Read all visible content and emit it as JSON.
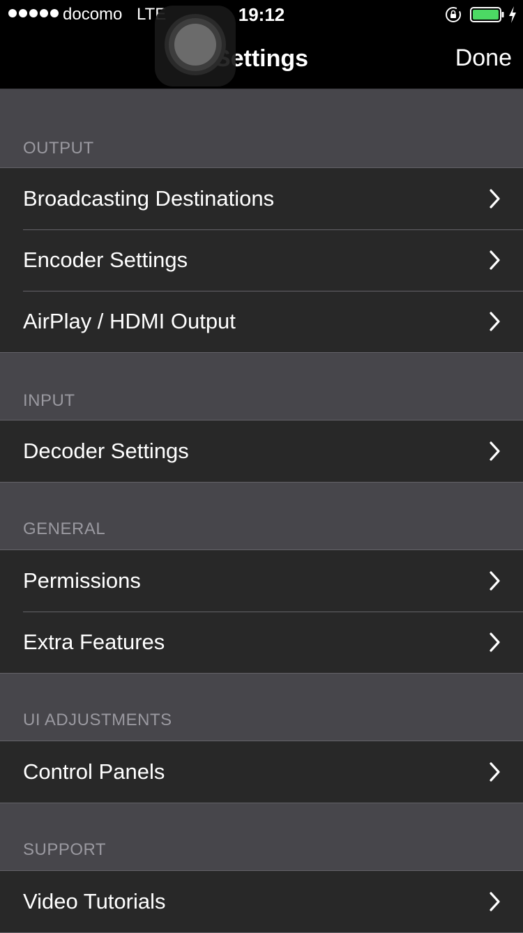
{
  "status_bar": {
    "carrier": "docomo",
    "network": "LTE",
    "time": "19:12",
    "signal_bars": 5
  },
  "nav": {
    "title": "Settings",
    "done_label": "Done"
  },
  "sections": [
    {
      "header": "OUTPUT",
      "items": [
        {
          "label": "Broadcasting Destinations"
        },
        {
          "label": "Encoder Settings"
        },
        {
          "label": "AirPlay / HDMI Output"
        }
      ]
    },
    {
      "header": "INPUT",
      "items": [
        {
          "label": "Decoder Settings"
        }
      ]
    },
    {
      "header": "GENERAL",
      "items": [
        {
          "label": "Permissions"
        },
        {
          "label": "Extra Features"
        }
      ]
    },
    {
      "header": "UI ADJUSTMENTS",
      "items": [
        {
          "label": "Control Panels"
        }
      ]
    },
    {
      "header": "SUPPORT",
      "items": [
        {
          "label": "Video Tutorials"
        }
      ]
    }
  ],
  "icons": {
    "chevron": "chevron-right-icon",
    "lock": "rotation-lock-icon",
    "battery": "battery-icon",
    "charging": "charging-bolt-icon",
    "assistive": "assistive-touch-icon"
  },
  "colors": {
    "background": "#47464b",
    "row_background": "#282828",
    "header_text": "#9a99a0",
    "battery_fill": "#4cd964"
  }
}
